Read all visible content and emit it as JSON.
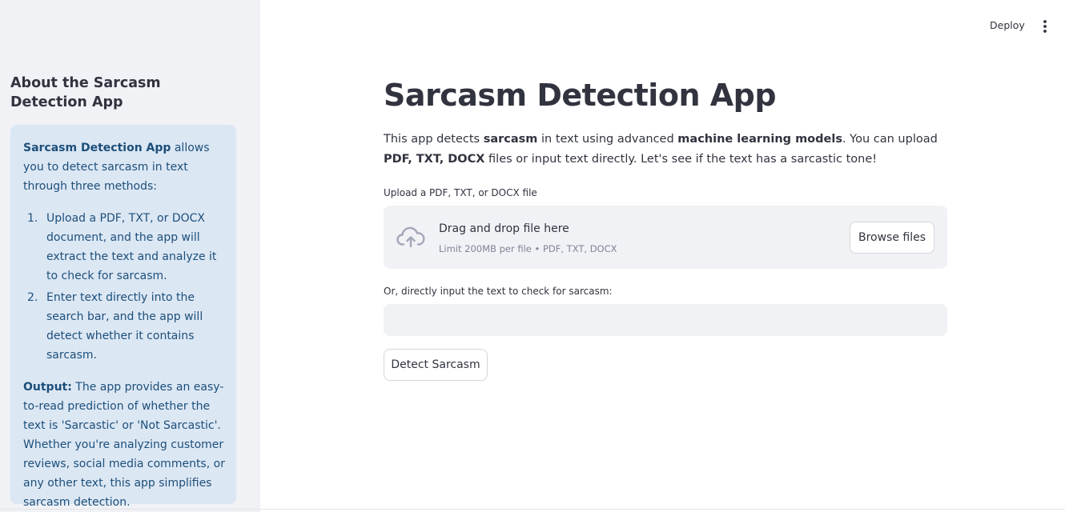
{
  "header": {
    "deploy_label": "Deploy",
    "menu_icon": "more-vertical-icon"
  },
  "sidebar": {
    "title": "About the Sarcasm Detection App",
    "info": {
      "intro_bold": "Sarcasm Detection App",
      "intro_rest": " allows you to detect sarcasm in text through three methods:",
      "steps": [
        {
          "num": "1.",
          "text": "Upload a PDF, TXT, or DOCX document, and the app will extract the text and analyze it to check for sarcasm."
        },
        {
          "num": "2.",
          "text": "Enter text directly into the search bar, and the app will detect whether it contains sarcasm."
        }
      ],
      "output_bold": "Output:",
      "output_rest": " The app provides an easy-to-read prediction of whether the text is 'Sarcastic' or 'Not Sarcastic'. Whether you're analyzing customer reviews, social media comments, or any other text, this app simplifies sarcasm detection."
    }
  },
  "main": {
    "title": "Sarcasm Detection App",
    "intro": {
      "p1": "This app detects ",
      "b1": "sarcasm",
      "p2": " in text using advanced ",
      "b2": "machine learning models",
      "p3": ". You can upload ",
      "b3": "PDF, TXT, DOCX",
      "p4": " files or input text directly. Let's see if the text has a sarcastic tone!"
    },
    "upload": {
      "label": "Upload a PDF, TXT, or DOCX file",
      "drop_title": "Drag and drop file here",
      "drop_limit": "Limit 200MB per file • PDF, TXT, DOCX",
      "browse_label": "Browse files",
      "icon": "cloud-upload-icon"
    },
    "text_input": {
      "label": "Or, directly input the text to check for sarcasm:",
      "value": "",
      "placeholder": ""
    },
    "detect_label": "Detect Sarcasm"
  },
  "colors": {
    "sidebar_bg": "#f0f2f6",
    "info_bg": "#dce7f4",
    "info_text": "#1c4f7a",
    "text": "#31333f",
    "muted": "#808495"
  }
}
